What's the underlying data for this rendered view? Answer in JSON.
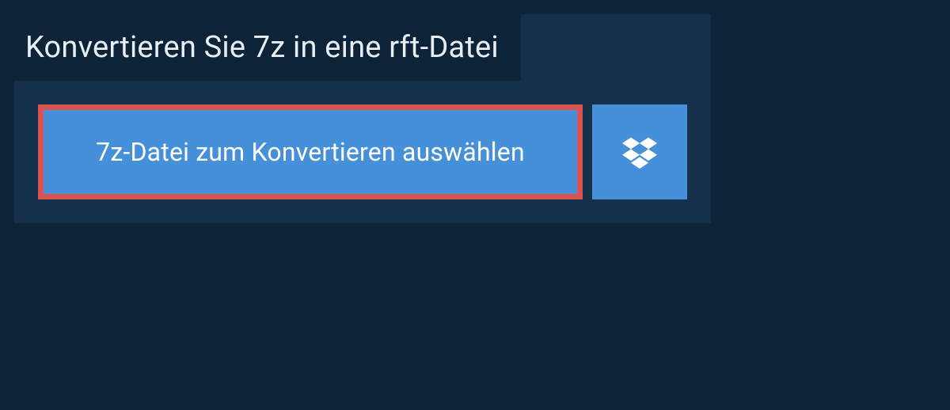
{
  "header": {
    "title": "Konvertieren Sie 7z in eine rft-Datei"
  },
  "actions": {
    "select_file_label": "7z-Datei zum Konvertieren auswählen",
    "dropbox_icon": "dropbox"
  },
  "colors": {
    "page_bg": "#0d2438",
    "card_bg": "#14304b",
    "button_bg": "#4690d9",
    "highlight_border": "#d9544f",
    "text_light": "#e8eef4"
  }
}
